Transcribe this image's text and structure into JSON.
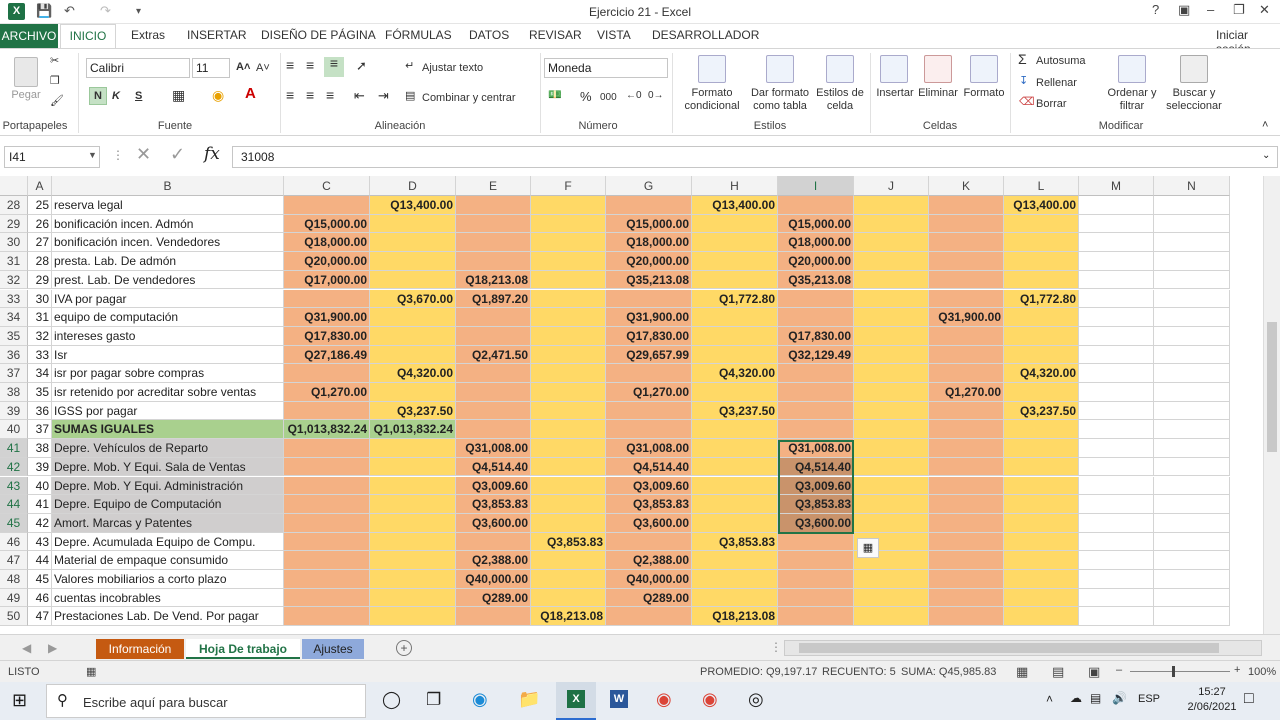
{
  "app": {
    "title": "Ejercicio 21 - Excel",
    "sign_in": "Iniciar sesión",
    "help": "?"
  },
  "tabs": [
    "ARCHIVO",
    "INICIO",
    "Extras",
    "INSERTAR",
    "DISEÑO DE PÁGINA",
    "FÓRMULAS",
    "DATOS",
    "REVISAR",
    "VISTA",
    "DESARROLLADOR"
  ],
  "ribbon": {
    "clipboard": {
      "label": "Portapapeles",
      "paste": "Pegar"
    },
    "font": {
      "label": "Fuente",
      "name": "Calibri",
      "size": "11",
      "bold": "N",
      "italic": "K",
      "underline": "S"
    },
    "alignment": {
      "label": "Alineación",
      "wrap": "Ajustar texto",
      "merge": "Combinar y centrar"
    },
    "number": {
      "label": "Número",
      "format": "Moneda",
      "percent": "%",
      "thousands": "000"
    },
    "styles": {
      "label": "Estilos",
      "conditional": [
        "Formato",
        "condicional"
      ],
      "table": [
        "Dar formato",
        "como tabla"
      ],
      "cell": [
        "Estilos de",
        "celda"
      ]
    },
    "cells": {
      "label": "Celdas",
      "insert": "Insertar",
      "delete": "Eliminar",
      "format": "Formato"
    },
    "edit": {
      "label": "Modificar",
      "autosum": "Autosuma",
      "fill": "Rellenar",
      "clear": "Borrar",
      "sort": [
        "Ordenar y",
        "filtrar"
      ],
      "find": [
        "Buscar y",
        "seleccionar"
      ]
    }
  },
  "formula_bar": {
    "name_box": "I41",
    "fx": "fx",
    "value": "31008"
  },
  "columns": [
    "A",
    "B",
    "C",
    "D",
    "E",
    "F",
    "G",
    "H",
    "I",
    "J",
    "K",
    "L",
    "M",
    "N"
  ],
  "rows": [
    {
      "r": "28",
      "a": "25",
      "b": "reserva legal",
      "c": "",
      "d": "Q13,400.00",
      "e": "",
      "f": "",
      "g": "",
      "h": "Q13,400.00",
      "i": "",
      "j": "",
      "k": "",
      "l": "Q13,400.00"
    },
    {
      "r": "29",
      "a": "26",
      "b": "bonificación incen. Admón",
      "c": "Q15,000.00",
      "d": "",
      "e": "",
      "f": "",
      "g": "Q15,000.00",
      "h": "",
      "i": "Q15,000.00",
      "j": "",
      "k": "",
      "l": ""
    },
    {
      "r": "30",
      "a": "27",
      "b": "bonificación incen. Vendedores",
      "c": "Q18,000.00",
      "d": "",
      "e": "",
      "f": "",
      "g": "Q18,000.00",
      "h": "",
      "i": "Q18,000.00",
      "j": "",
      "k": "",
      "l": ""
    },
    {
      "r": "31",
      "a": "28",
      "b": "presta. Lab. De admón",
      "c": "Q20,000.00",
      "d": "",
      "e": "",
      "f": "",
      "g": "Q20,000.00",
      "h": "",
      "i": "Q20,000.00",
      "j": "",
      "k": "",
      "l": ""
    },
    {
      "r": "32",
      "a": "29",
      "b": "prest. Lab. De vendedores",
      "c": "Q17,000.00",
      "d": "",
      "e": "Q18,213.08",
      "f": "",
      "g": "Q35,213.08",
      "h": "",
      "i": "Q35,213.08",
      "j": "",
      "k": "",
      "l": ""
    },
    {
      "r": "33",
      "a": "30",
      "b": "IVA por pagar",
      "c": "",
      "d": "Q3,670.00",
      "e": "Q1,897.20",
      "f": "",
      "g": "",
      "h": "Q1,772.80",
      "i": "",
      "j": "",
      "k": "",
      "l": "Q1,772.80"
    },
    {
      "r": "34",
      "a": "31",
      "b": "equipo de computación",
      "c": "Q31,900.00",
      "d": "",
      "e": "",
      "f": "",
      "g": "Q31,900.00",
      "h": "",
      "i": "",
      "j": "",
      "k": "Q31,900.00",
      "l": ""
    },
    {
      "r": "35",
      "a": "32",
      "b": "intereses gasto",
      "c": "Q17,830.00",
      "d": "",
      "e": "",
      "f": "",
      "g": "Q17,830.00",
      "h": "",
      "i": "Q17,830.00",
      "j": "",
      "k": "",
      "l": ""
    },
    {
      "r": "36",
      "a": "33",
      "b": "Isr",
      "c": "Q27,186.49",
      "d": "",
      "e": "Q2,471.50",
      "f": "",
      "g": "Q29,657.99",
      "h": "",
      "i": "Q32,129.49",
      "j": "",
      "k": "",
      "l": ""
    },
    {
      "r": "37",
      "a": "34",
      "b": "isr por pagar sobre compras",
      "c": "",
      "d": "Q4,320.00",
      "e": "",
      "f": "",
      "g": "",
      "h": "Q4,320.00",
      "i": "",
      "j": "",
      "k": "",
      "l": "Q4,320.00"
    },
    {
      "r": "38",
      "a": "35",
      "b": "isr retenido por acreditar sobre ventas",
      "c": "Q1,270.00",
      "d": "",
      "e": "",
      "f": "",
      "g": "Q1,270.00",
      "h": "",
      "i": "",
      "j": "",
      "k": "Q1,270.00",
      "l": ""
    },
    {
      "r": "39",
      "a": "36",
      "b": "IGSS por pagar",
      "c": "",
      "d": "Q3,237.50",
      "e": "",
      "f": "",
      "g": "",
      "h": "Q3,237.50",
      "i": "",
      "j": "",
      "k": "",
      "l": "Q3,237.50"
    },
    {
      "r": "40",
      "a": "37",
      "b": "SUMAS IGUALES",
      "c": "Q1,013,832.24",
      "d": "Q1,013,832.24",
      "e": "",
      "f": "",
      "g": "",
      "h": "",
      "i": "",
      "j": "",
      "k": "",
      "l": ""
    },
    {
      "r": "41",
      "a": "38",
      "b": "Depre. Vehículos de Reparto",
      "c": "",
      "d": "",
      "e": "Q31,008.00",
      "f": "",
      "g": "Q31,008.00",
      "h": "",
      "i": "Q31,008.00",
      "j": "",
      "k": "",
      "l": ""
    },
    {
      "r": "42",
      "a": "39",
      "b": "Depre. Mob. Y Equi. Sala de Ventas",
      "c": "",
      "d": "",
      "e": "Q4,514.40",
      "f": "",
      "g": "Q4,514.40",
      "h": "",
      "i": "Q4,514.40",
      "j": "",
      "k": "",
      "l": ""
    },
    {
      "r": "43",
      "a": "40",
      "b": "Depre. Mob. Y Equi. Administración",
      "c": "",
      "d": "",
      "e": "Q3,009.60",
      "f": "",
      "g": "Q3,009.60",
      "h": "",
      "i": "Q3,009.60",
      "j": "",
      "k": "",
      "l": ""
    },
    {
      "r": "44",
      "a": "41",
      "b": "Depre. Equipo de Computación",
      "c": "",
      "d": "",
      "e": "Q3,853.83",
      "f": "",
      "g": "Q3,853.83",
      "h": "",
      "i": "Q3,853.83",
      "j": "",
      "k": "",
      "l": ""
    },
    {
      "r": "45",
      "a": "42",
      "b": "Amort. Marcas y Patentes",
      "c": "",
      "d": "",
      "e": "Q3,600.00",
      "f": "",
      "g": "Q3,600.00",
      "h": "",
      "i": "Q3,600.00",
      "j": "",
      "k": "",
      "l": ""
    },
    {
      "r": "46",
      "a": "43",
      "b": "Depre. Acumulada Equipo de Compu.",
      "c": "",
      "d": "",
      "e": "",
      "f": "Q3,853.83",
      "g": "",
      "h": "Q3,853.83",
      "i": "",
      "j": "",
      "k": "",
      "l": ""
    },
    {
      "r": "47",
      "a": "44",
      "b": "Material de empaque consumido",
      "c": "",
      "d": "",
      "e": "Q2,388.00",
      "f": "",
      "g": "Q2,388.00",
      "h": "",
      "i": "",
      "j": "",
      "k": "",
      "l": ""
    },
    {
      "r": "48",
      "a": "45",
      "b": "Valores mobiliarios a corto plazo",
      "c": "",
      "d": "",
      "e": "Q40,000.00",
      "f": "",
      "g": "Q40,000.00",
      "h": "",
      "i": "",
      "j": "",
      "k": "",
      "l": ""
    },
    {
      "r": "49",
      "a": "46",
      "b": "cuentas incobrables",
      "c": "",
      "d": "",
      "e": "Q289.00",
      "f": "",
      "g": "Q289.00",
      "h": "",
      "i": "",
      "j": "",
      "k": "",
      "l": ""
    },
    {
      "r": "50",
      "a": "47",
      "b": "Prestaciones Lab. De Vend. Por pagar",
      "c": "",
      "d": "",
      "e": "",
      "f": "Q18,213.08",
      "g": "",
      "h": "Q18,213.08",
      "i": "",
      "j": "",
      "k": "",
      "l": ""
    }
  ],
  "sheets": [
    "Información",
    "Hoja De trabajo",
    "Ajustes"
  ],
  "status": {
    "mode": "LISTO",
    "avg": "PROMEDIO: Q9,197.17",
    "count": "RECUENTO: 5",
    "sum": "SUMA: Q45,985.83",
    "zoom": "100%"
  },
  "taskbar": {
    "search": "Escribe aquí para buscar",
    "lang": "ESP",
    "time": "15:27",
    "date": "2/06/2021"
  },
  "colors": {
    "orange": "#f4b183",
    "yellow": "#ffd966",
    "green": "#a9d08e",
    "gray": "#d0cece",
    "excel_green": "#217346"
  }
}
